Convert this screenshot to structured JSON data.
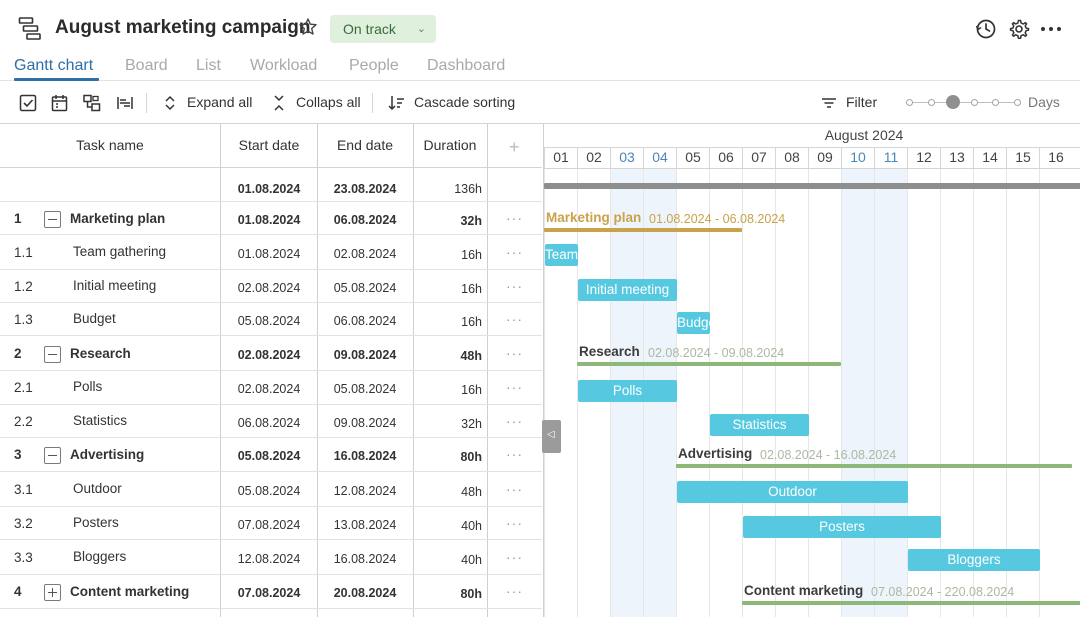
{
  "header": {
    "title": "August marketing campaign",
    "status": "On track",
    "icons": [
      "gantt-app-icon",
      "star-icon",
      "history-icon",
      "gear-icon",
      "more-icon"
    ]
  },
  "tabs": [
    {
      "label": "Gantt chart",
      "active": true
    },
    {
      "label": "Board"
    },
    {
      "label": "List"
    },
    {
      "label": "Workload"
    },
    {
      "label": "People"
    },
    {
      "label": "Dashboard"
    }
  ],
  "toolbar": {
    "expand_all": "Expand all",
    "collapse_all": "Collaps all",
    "cascade_sorting": "Cascade sorting",
    "filter": "Filter",
    "zoom_label": "Days",
    "zoom_level": 3,
    "zoom_steps": 6
  },
  "grid": {
    "columns": {
      "task": "Task name",
      "start": "Start date",
      "end": "End date",
      "duration": "Duration",
      "add": "+"
    },
    "total": {
      "start": "01.08.2024",
      "end": "23.08.2024",
      "duration": "136h"
    },
    "rows": [
      {
        "num": "1",
        "name": "Marketing plan",
        "start": "01.08.2024",
        "end": "06.08.2024",
        "duration": "32h",
        "group": true,
        "expanded": true
      },
      {
        "num": "1.1",
        "name": "Team gathering",
        "start": "01.08.2024",
        "end": "02.08.2024",
        "duration": "16h"
      },
      {
        "num": "1.2",
        "name": "Initial meeting",
        "start": "02.08.2024",
        "end": "05.08.2024",
        "duration": "16h"
      },
      {
        "num": "1.3",
        "name": "Budget",
        "start": "05.08.2024",
        "end": "06.08.2024",
        "duration": "16h"
      },
      {
        "num": "2",
        "name": "Research",
        "start": "02.08.2024",
        "end": "09.08.2024",
        "duration": "48h",
        "group": true,
        "expanded": true
      },
      {
        "num": "2.1",
        "name": "Polls",
        "start": "02.08.2024",
        "end": "05.08.2024",
        "duration": "16h"
      },
      {
        "num": "2.2",
        "name": "Statistics",
        "start": "06.08.2024",
        "end": "09.08.2024",
        "duration": "32h"
      },
      {
        "num": "3",
        "name": "Advertising",
        "start": "05.08.2024",
        "end": "16.08.2024",
        "duration": "80h",
        "group": true,
        "expanded": true
      },
      {
        "num": "3.1",
        "name": "Outdoor",
        "start": "05.08.2024",
        "end": "12.08.2024",
        "duration": "48h"
      },
      {
        "num": "3.2",
        "name": "Posters",
        "start": "07.08.2024",
        "end": "13.08.2024",
        "duration": "40h"
      },
      {
        "num": "3.3",
        "name": "Bloggers",
        "start": "12.08.2024",
        "end": "16.08.2024",
        "duration": "40h"
      },
      {
        "num": "4",
        "name": "Content marketing",
        "start": "07.08.2024",
        "end": "20.08.2024",
        "duration": "80h",
        "group": true,
        "expanded": false
      }
    ]
  },
  "timeline": {
    "month": "August 2024",
    "days": [
      "01",
      "02",
      "03",
      "04",
      "05",
      "06",
      "07",
      "08",
      "09",
      "10",
      "11",
      "12",
      "13",
      "14",
      "15",
      "16"
    ],
    "weekend_days": [
      "03",
      "04",
      "10",
      "11"
    ],
    "bars": [
      {
        "label": "Team..",
        "task": "1.1"
      },
      {
        "label": "Initial meeting",
        "task": "1.2"
      },
      {
        "label": "Budget",
        "task": "1.3"
      },
      {
        "label": "Polls",
        "task": "2.1"
      },
      {
        "label": "Statistics",
        "task": "2.2"
      },
      {
        "label": "Outdoor",
        "task": "3.1"
      },
      {
        "label": "Posters",
        "task": "3.2"
      },
      {
        "label": "Bloggers",
        "task": "3.3"
      }
    ],
    "summaries": [
      {
        "label": "Marketing plan",
        "range": "01.08.2024 - 06.08.2024",
        "color": "#c9a24a"
      },
      {
        "label": "Research",
        "range": "02.08.2024 - 09.08.2024",
        "color": "#8cb97a"
      },
      {
        "label": "Advertising",
        "range": "02.08.2024 - 16.08.2024",
        "color": "#8cb97a"
      },
      {
        "label": "Content marketing",
        "range": "07.08.2024 - 220.08.2024",
        "color": "#8cb97a"
      }
    ],
    "colors": {
      "task_bar": "#56c9e0",
      "project_bar": "#8e8e8e",
      "weekend": "#eef4fb",
      "weekend_text": "#4a86b8"
    }
  }
}
